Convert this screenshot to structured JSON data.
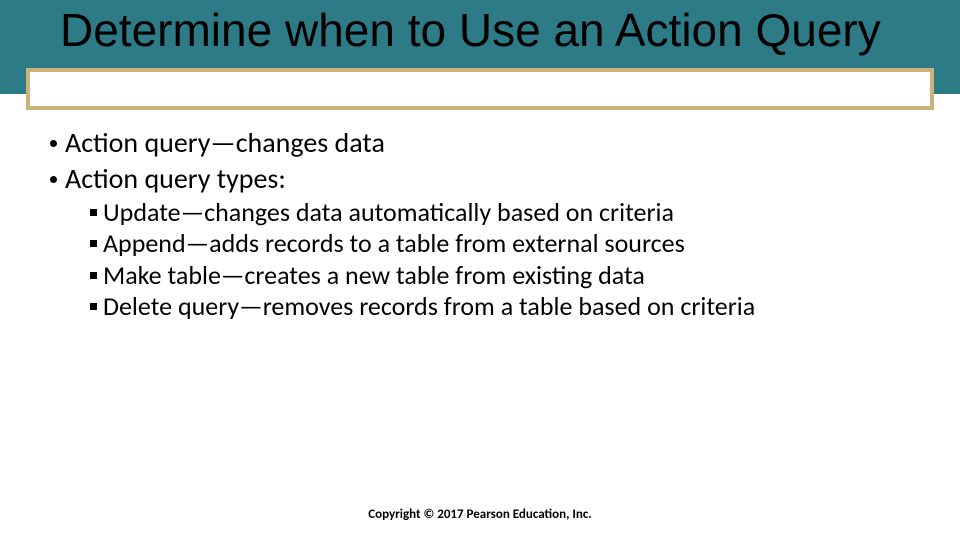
{
  "title": "Determine when to Use an Action Query",
  "bullets": [
    {
      "text": "Action query—changes data"
    },
    {
      "text": "Action query types:"
    }
  ],
  "sub_bullets": [
    "Update—changes data automatically based on criteria",
    "Append—adds records to a table from external sources",
    "Make table—creates a new table from existing data",
    "Delete query—removes records from a table based on criteria"
  ],
  "copyright": "Copyright © 2017 Pearson Education, Inc."
}
